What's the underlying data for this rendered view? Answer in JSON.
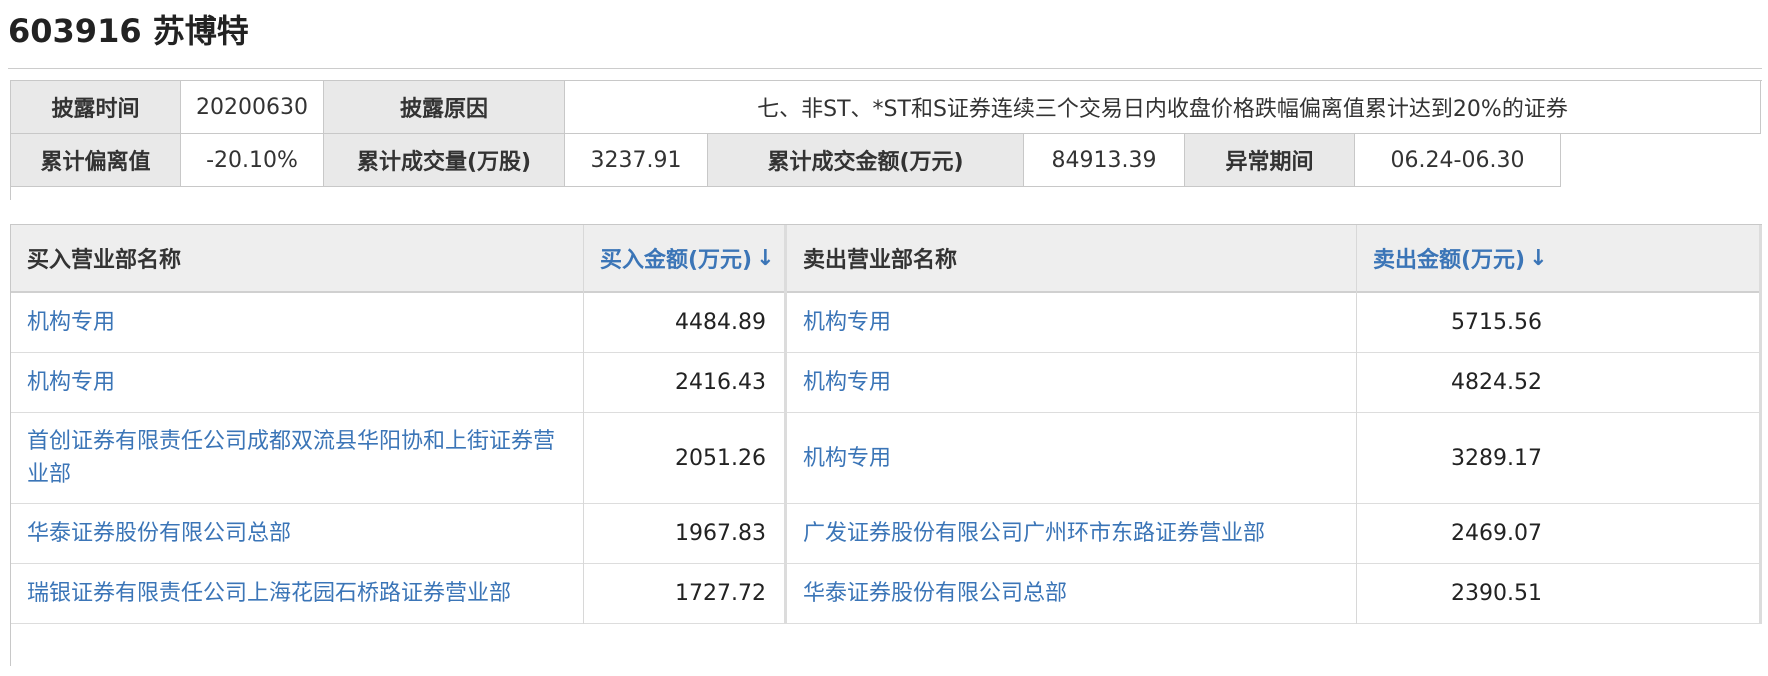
{
  "title": "603916 苏博特",
  "info": {
    "disclosure_time_label": "披露时间",
    "disclosure_time_value": "20200630",
    "disclosure_reason_label": "披露原因",
    "disclosure_reason_value": "七、非ST、*ST和S证券连续三个交易日内收盘价格跌幅偏离值累计达到20%的证券",
    "deviation_label": "累计偏离值",
    "deviation_value": "-20.10%",
    "volume_label": "累计成交量(万股)",
    "volume_value": "3237.91",
    "amount_label": "累计成交金额(万元)",
    "amount_value": "84913.39",
    "period_label": "异常期间",
    "period_value": "06.24-06.30"
  },
  "trades": {
    "headers": {
      "buy_name": "买入营业部名称",
      "buy_amount": "买入金额(万元)",
      "sell_name": "卖出营业部名称",
      "sell_amount": "卖出金额(万元)",
      "sort_icon": "↓"
    },
    "rows": [
      {
        "buy_name": "机构专用",
        "buy_amount": "4484.89",
        "sell_name": "机构专用",
        "sell_amount": "5715.56"
      },
      {
        "buy_name": "机构专用",
        "buy_amount": "2416.43",
        "sell_name": "机构专用",
        "sell_amount": "4824.52"
      },
      {
        "buy_name": "首创证券有限责任公司成都双流县华阳协和上街证券营业部",
        "buy_amount": "2051.26",
        "sell_name": "机构专用",
        "sell_amount": "3289.17"
      },
      {
        "buy_name": "华泰证券股份有限公司总部",
        "buy_amount": "1967.83",
        "sell_name": "广发证券股份有限公司广州环市东路证券营业部",
        "sell_amount": "2469.07"
      },
      {
        "buy_name": "瑞银证券有限责任公司上海花园石桥路证券营业部",
        "buy_amount": "1727.72",
        "sell_name": "华泰证券股份有限公司总部",
        "sell_amount": "2390.51"
      }
    ]
  },
  "colors": {
    "link": "#3b75b7",
    "header_bg": "#e9e9e9",
    "border": "#c8c8c8"
  }
}
